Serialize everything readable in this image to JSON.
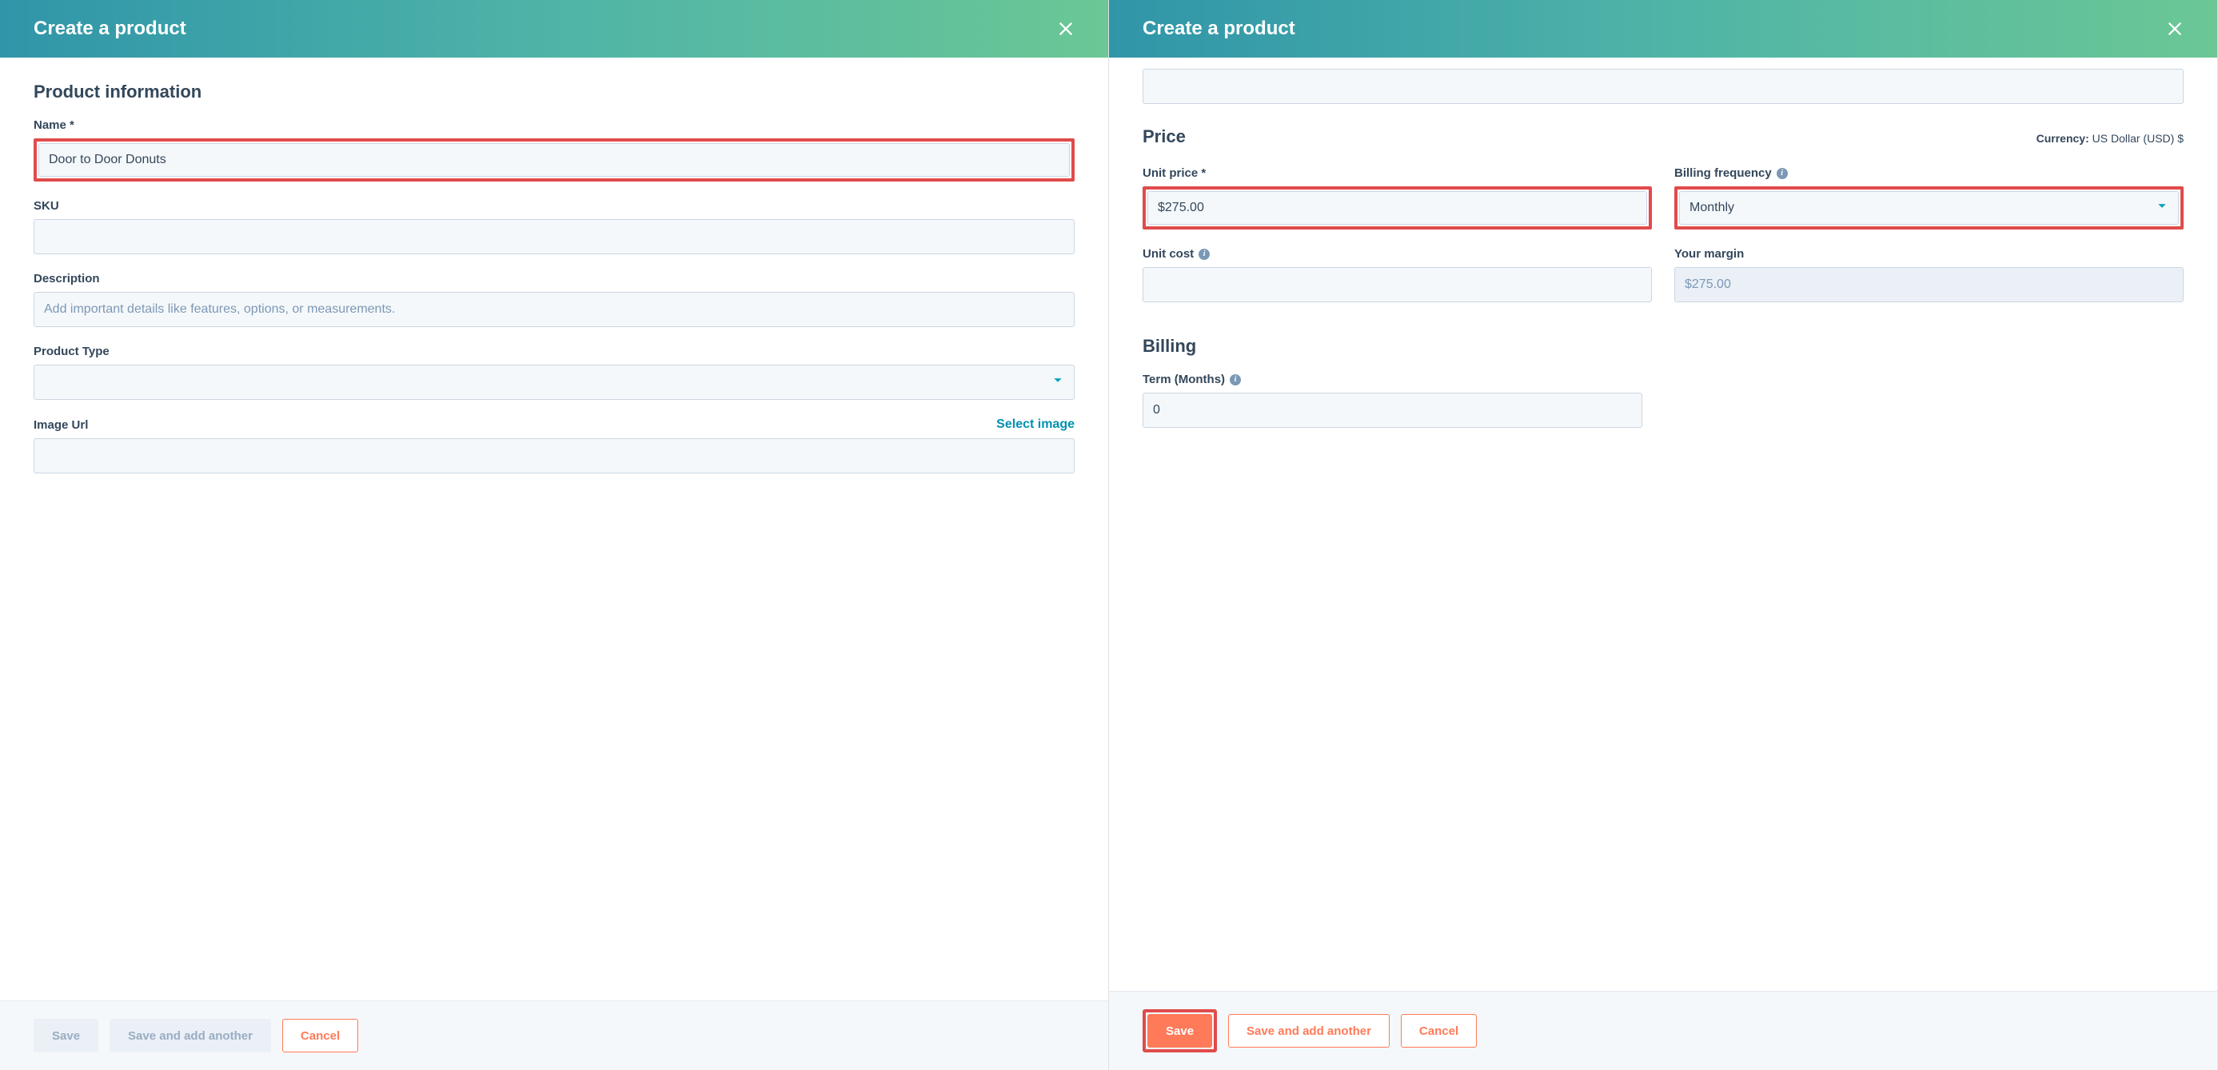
{
  "left_panel": {
    "header_title": "Create a product",
    "section_title": "Product information",
    "fields": {
      "name_label": "Name *",
      "name_value": "Door to Door Donuts",
      "sku_label": "SKU",
      "sku_value": "",
      "description_label": "Description",
      "description_placeholder": "Add important details like features, options, or measurements.",
      "product_type_label": "Product Type",
      "product_type_value": "",
      "image_url_label": "Image Url",
      "select_image_link": "Select image",
      "image_url_value": ""
    },
    "footer": {
      "save": "Save",
      "save_add_another": "Save and add another",
      "cancel": "Cancel"
    }
  },
  "right_panel": {
    "header_title": "Create a product",
    "price_section_title": "Price",
    "currency_prefix": "Currency:",
    "currency_value": "US Dollar (USD) $",
    "fields": {
      "unit_price_label": "Unit price *",
      "unit_price_value": "$275.00",
      "billing_freq_label": "Billing frequency",
      "billing_freq_value": "Monthly",
      "unit_cost_label": "Unit cost",
      "unit_cost_value": "",
      "margin_label": "Your margin",
      "margin_value": "$275.00"
    },
    "billing_section_title": "Billing",
    "term_label": "Term (Months)",
    "term_value": "0",
    "footer": {
      "save": "Save",
      "save_add_another": "Save and add another",
      "cancel": "Cancel"
    }
  }
}
